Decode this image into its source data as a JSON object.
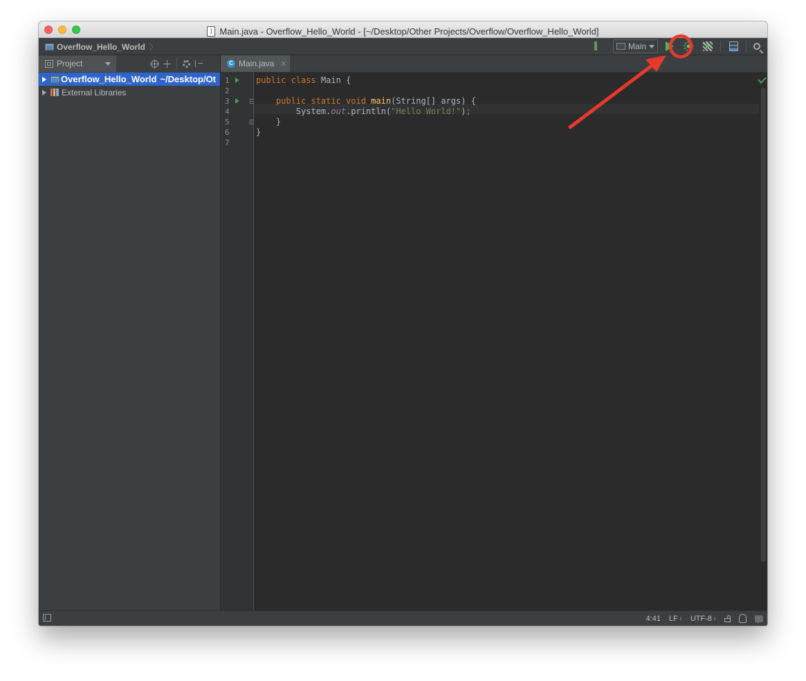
{
  "window": {
    "title": "Main.java - Overflow_Hello_World - [~/Desktop/Other Projects/Overflow/Overflow_Hello_World]",
    "file_icon_glyph": "j"
  },
  "navbar": {
    "breadcrumb": "Overflow_Hello_World",
    "run_config": "Main"
  },
  "project_panel": {
    "tab_label": "Project",
    "tree": [
      {
        "name": "Overflow_Hello_World",
        "path": "~/Desktop/Ot",
        "selected": true
      },
      {
        "name": "External Libraries",
        "selected": false
      }
    ]
  },
  "editor": {
    "tab_label": "Main.java",
    "tab_icon_glyph": "C",
    "line_numbers": [
      "1",
      "2",
      "3",
      "4",
      "5",
      "6",
      "7"
    ],
    "lines": {
      "l1": {
        "kw": "public class ",
        "rest": "Main {"
      },
      "l3": {
        "kw": "public static void ",
        "fn": "main",
        "rest": "(String[] args) {"
      },
      "l4": {
        "pre": "System.",
        "field": "out",
        "mid": ".println(",
        "str": "\"Hello World!\"",
        "post": ")",
        "semi": ";"
      },
      "l5": "}",
      "l6": "}"
    }
  },
  "status_bar": {
    "position": "4:41",
    "line_sep": "LF",
    "encoding": "UTF-8",
    "updown_glyph": "↕"
  },
  "colors": {
    "annotation_red": "#e8392d",
    "selection_blue": "#2f65ca",
    "run_green": "#57b357"
  }
}
